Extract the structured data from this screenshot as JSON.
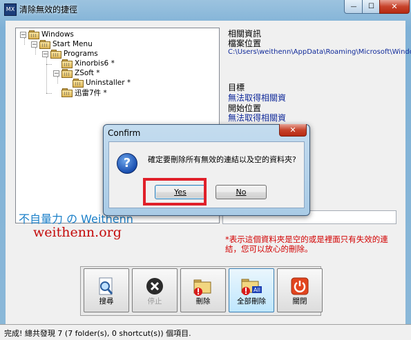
{
  "window": {
    "title": "清除無效的捷徑",
    "app_icon_text": "MX",
    "min_symbol": "—",
    "max_symbol": "☐",
    "close_symbol": "✕"
  },
  "tree": {
    "nodes": [
      {
        "label": "Windows",
        "expanded": true
      },
      {
        "label": "Start Menu",
        "expanded": true
      },
      {
        "label": "Programs",
        "expanded": true
      },
      {
        "label": "Xinorbis6 *",
        "expanded": false
      },
      {
        "label": "ZSoft *",
        "expanded": true
      },
      {
        "label": "Uninstaller *",
        "expanded": false
      },
      {
        "label": "迅雷7件 *",
        "expanded": false
      }
    ],
    "expand_symbol": "−"
  },
  "info": {
    "section_title": "相關資訊",
    "file_location_label": "檔案位置",
    "file_location_value": "C:\\Users\\weithenn\\AppData\\Roaming\\Microsoft\\Windo",
    "target_label": "目標",
    "target_value": "無法取得相關資",
    "start_in_label": "開始位置",
    "start_in_value": "無法取得相關資"
  },
  "note": "*表示這個資料夾是空的或是裡面只有失效的連結，您可以放心的刪除。",
  "watermark": {
    "line1": "不自量力 の Weithenn",
    "line2": "weithenn.org"
  },
  "toolbar": {
    "search_label": "搜尋",
    "stop_label": "停止",
    "delete_label": "刪除",
    "delete_all_label": "全部刪除",
    "close_label": "關閉"
  },
  "status": {
    "text": "完成! 總共發現 7 (7 folder(s), 0 shortcut(s)) 個項目."
  },
  "dialog": {
    "title": "Confirm",
    "message": "確定要刪除所有無效的連結以及空的資料夾?",
    "yes_label": "Yes",
    "no_label": "No",
    "close_symbol": "✕",
    "icon_glyph": "?"
  },
  "colors": {
    "highlight": "#e0202a",
    "note": "#d20000",
    "link_value": "#102a9a",
    "watermark_blue": "#1a7fc8",
    "watermark_red": "#c40a0a"
  }
}
